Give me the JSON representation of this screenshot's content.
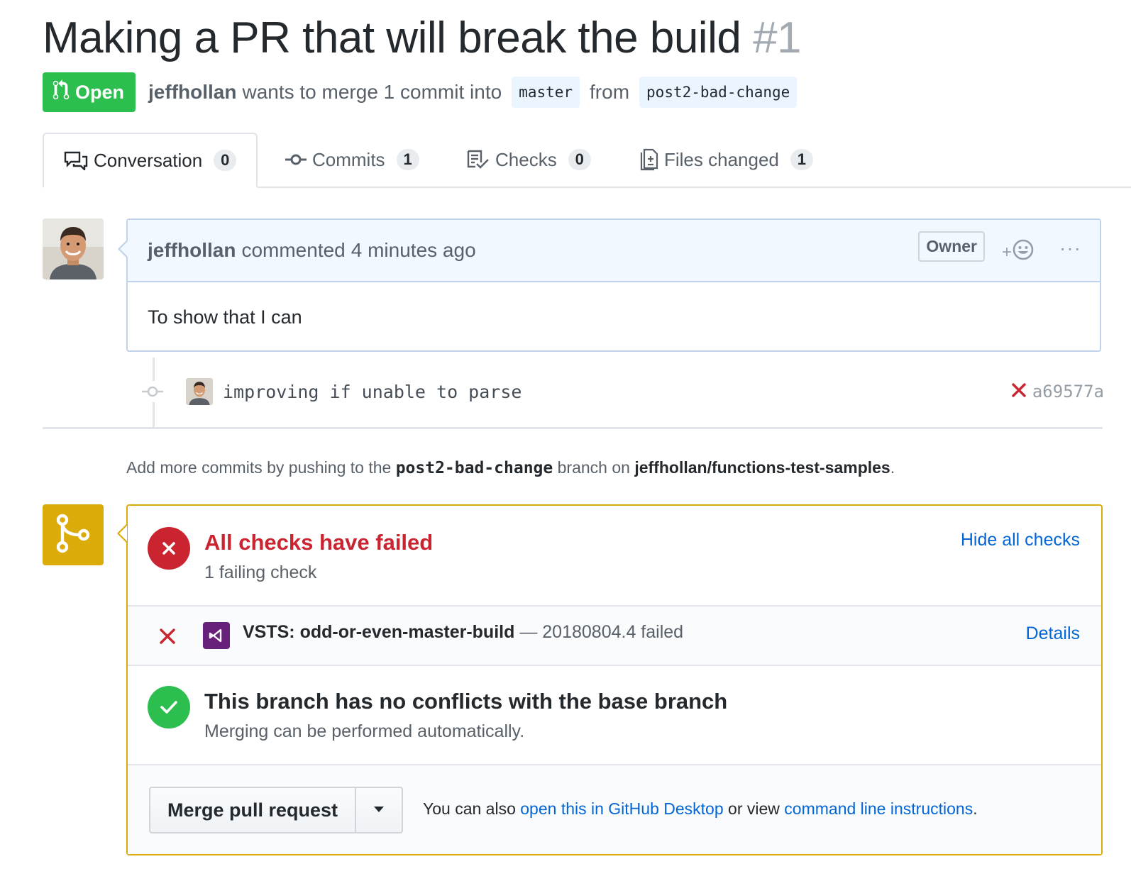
{
  "pr": {
    "title": "Making a PR that will break the build",
    "number": "#1",
    "state": "Open",
    "author": "jeffhollan",
    "merge_text": "wants to merge 1 commit into",
    "base_branch": "master",
    "from_text": "from",
    "head_branch": "post2-bad-change"
  },
  "tabs": [
    {
      "label": "Conversation",
      "count": "0",
      "icon": "comment-discussion-icon",
      "selected": true
    },
    {
      "label": "Commits",
      "count": "1",
      "icon": "git-commit-icon",
      "selected": false
    },
    {
      "label": "Checks",
      "count": "0",
      "icon": "checklist-icon",
      "selected": false
    },
    {
      "label": "Files changed",
      "count": "1",
      "icon": "diff-icon",
      "selected": false
    }
  ],
  "comment": {
    "author": "jeffhollan",
    "action": "commented",
    "time": "4 minutes ago",
    "role": "Owner",
    "reaction_plus": "+",
    "more": "···",
    "body": "To show that I can"
  },
  "commit": {
    "message": "improving if unable to parse",
    "sha": "a69577a",
    "status": "failed"
  },
  "push_note": {
    "prefix": "Add more commits by pushing to the",
    "branch": "post2-bad-change",
    "middle": "branch on",
    "repo": "jeffhollan/functions-test-samples",
    "suffix": "."
  },
  "checks": {
    "title": "All checks have failed",
    "subtitle": "1 failing check",
    "toggle_link": "Hide all checks",
    "items": [
      {
        "name": "VSTS: odd-or-even-master-build",
        "separator": "—",
        "description": "20180804.4 failed",
        "details_link": "Details"
      }
    ]
  },
  "conflicts": {
    "title": "This branch has no conflicts with the base branch",
    "subtitle": "Merging can be performed automatically."
  },
  "merge": {
    "button_label": "Merge pull request",
    "alt_prefix": "You can also",
    "desktop_link": "open this in GitHub Desktop",
    "alt_middle": "or view",
    "cli_link": "command line instructions",
    "alt_suffix": "."
  },
  "colors": {
    "open_green": "#2cbe4e",
    "fail_red": "#cb2431",
    "link_blue": "#0366d6",
    "warning_yellow": "#dbab09",
    "vs_purple": "#68217a"
  }
}
